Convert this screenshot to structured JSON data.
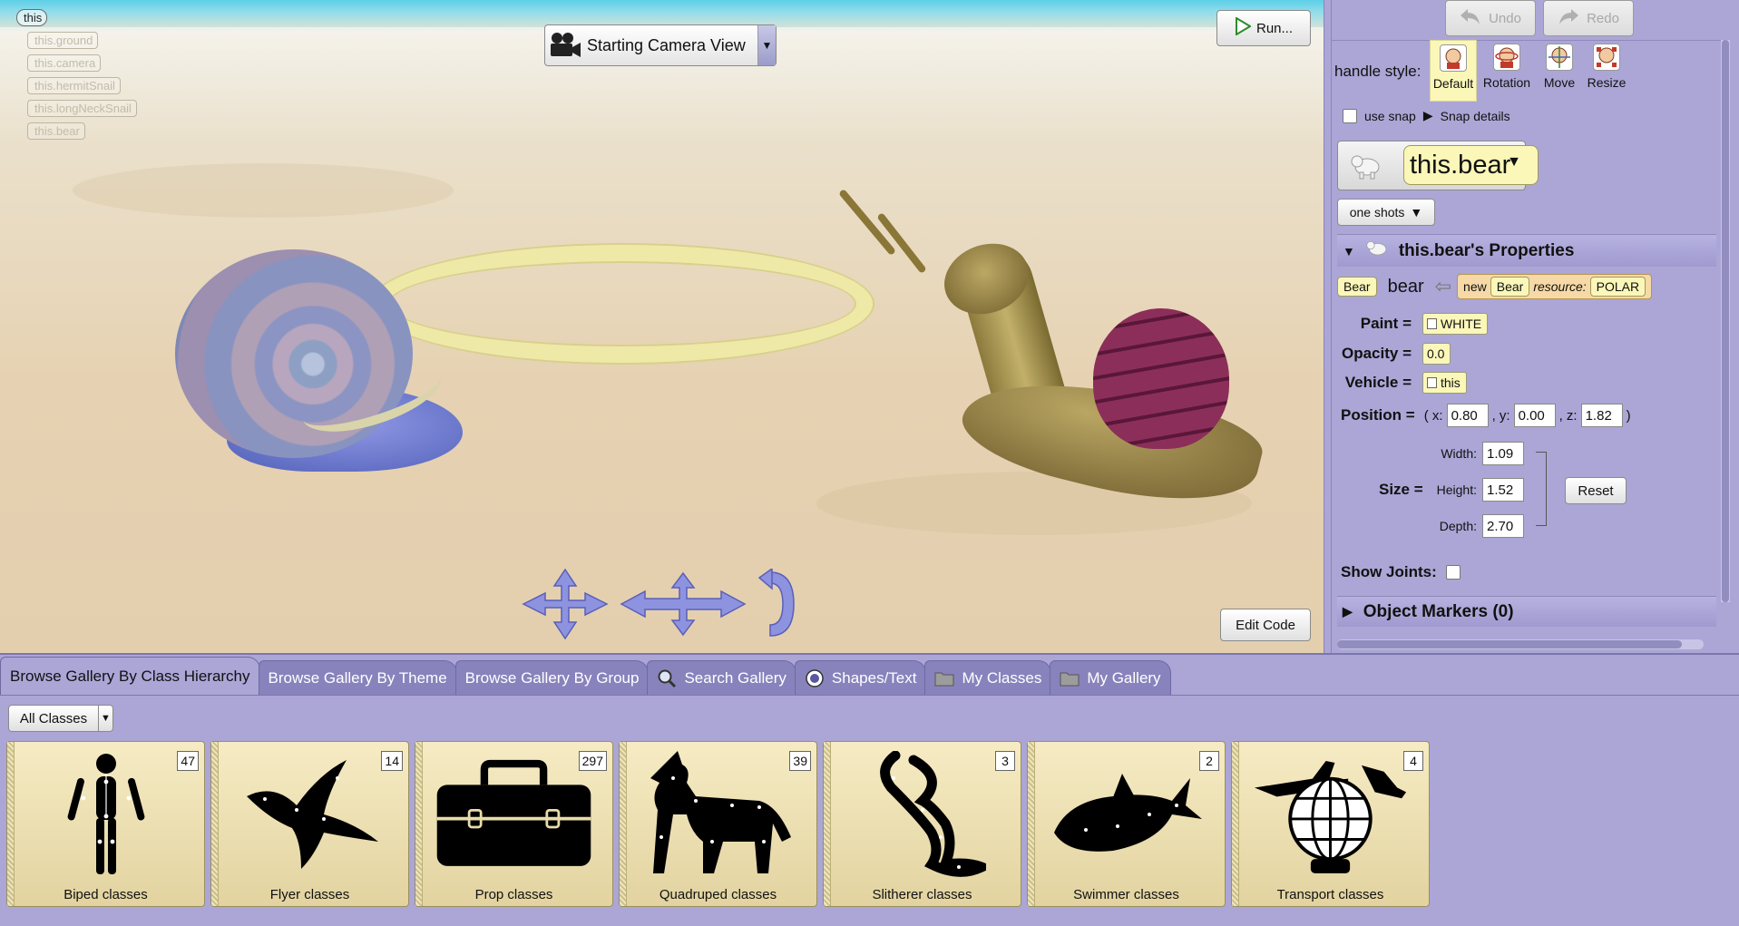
{
  "scene": {
    "object_tree": [
      "this",
      "this.ground",
      "this.camera",
      "this.hermitSnail",
      "this.longNeckSnail",
      "this.bear"
    ],
    "camera_view": "Starting Camera View",
    "run_label": "Run...",
    "edit_code_label": "Edit Code"
  },
  "toolbar": {
    "undo_label": "Undo",
    "redo_label": "Redo"
  },
  "handle_style": {
    "label": "handle style:",
    "options": [
      "Default",
      "Rotation",
      "Move",
      "Resize"
    ],
    "selected": "Default"
  },
  "snap": {
    "use_snap_label": "use snap",
    "details_label": "Snap details",
    "checked": false
  },
  "selected_object": {
    "name": "this.bear",
    "one_shots_label": "one shots"
  },
  "properties": {
    "header": "this.bear's Properties",
    "declaration": {
      "type_tile": "Bear",
      "var_name": "bear",
      "new_label": "new",
      "class_tile": "Bear",
      "resource_label": "resource:",
      "resource_value": "POLAR"
    },
    "paint_label": "Paint =",
    "paint_value": "WHITE",
    "opacity_label": "Opacity =",
    "opacity_value": "0.0",
    "vehicle_label": "Vehicle =",
    "vehicle_value": "this",
    "position_label": "Position =",
    "position": {
      "x": "0.80",
      "y": "0.00",
      "z": "1.82"
    },
    "size_label": "Size =",
    "width_label": "Width:",
    "width": "1.09",
    "height_label": "Height:",
    "height": "1.52",
    "depth_label": "Depth:",
    "depth": "2.70",
    "reset_label": "Reset",
    "show_joints_label": "Show Joints:",
    "markers_label": "Object Markers (0)"
  },
  "gallery": {
    "tabs": [
      "Browse Gallery By Class Hierarchy",
      "Browse Gallery By Theme",
      "Browse Gallery By Group",
      "Search Gallery",
      "Shapes/Text",
      "My Classes",
      "My Gallery"
    ],
    "active_tab": 0,
    "class_filter": "All Classes",
    "cards": [
      {
        "label": "Biped classes",
        "count": "47"
      },
      {
        "label": "Flyer classes",
        "count": "14"
      },
      {
        "label": "Prop classes",
        "count": "297"
      },
      {
        "label": "Quadruped classes",
        "count": "39"
      },
      {
        "label": "Slitherer classes",
        "count": "3"
      },
      {
        "label": "Swimmer classes",
        "count": "2"
      },
      {
        "label": "Transport classes",
        "count": "4"
      }
    ]
  },
  "colors": {
    "panel_bg": "#ABA6D6",
    "tile_yellow": "#FBF7B9",
    "sand": "#E6D2B2",
    "sky": "#5CCFE8"
  }
}
